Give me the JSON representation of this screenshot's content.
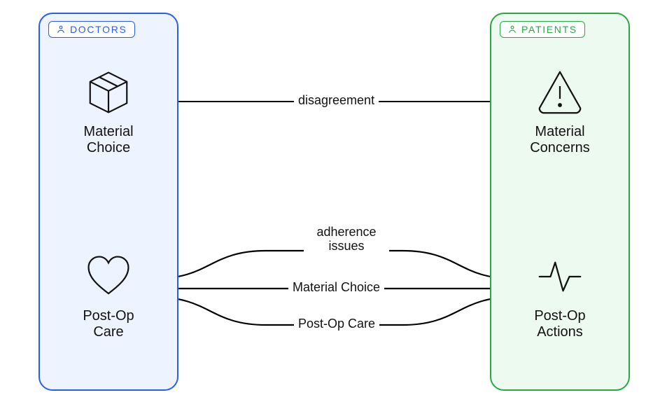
{
  "diagram": {
    "groups": {
      "doctors": {
        "title": "DOCTORS"
      },
      "patients": {
        "title": "PATIENTS"
      }
    },
    "nodes": {
      "doc_material": {
        "label": "Material\nChoice",
        "icon": "box-icon"
      },
      "doc_postop": {
        "label": "Post-Op\nCare",
        "icon": "heart-icon"
      },
      "pat_concerns": {
        "label": "Material\nConcerns",
        "icon": "warning-triangle-icon"
      },
      "pat_postop": {
        "label": "Post-Op\nActions",
        "icon": "activity-icon"
      }
    },
    "edges": {
      "disagreement": {
        "label": "disagreement"
      },
      "adherence": {
        "label": "adherence\nissues"
      },
      "mat_choice": {
        "label": "Material Choice"
      },
      "postop_care": {
        "label": "Post-Op Care"
      }
    }
  }
}
